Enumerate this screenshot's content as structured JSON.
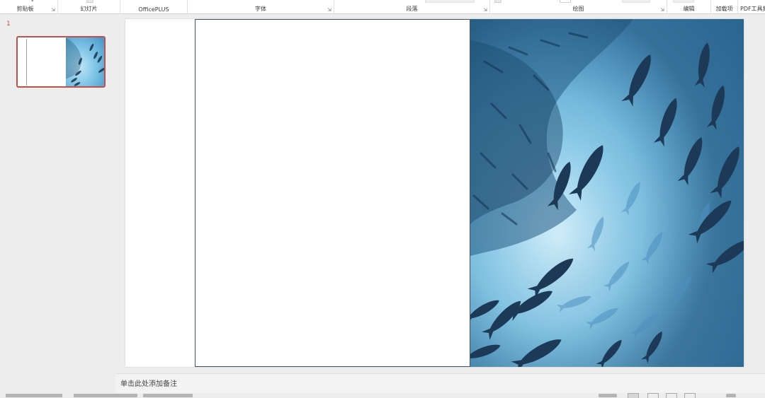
{
  "ribbon": {
    "groups": [
      {
        "label": "剪贴板",
        "launcher": "⇲"
      },
      {
        "label": "幻灯片"
      },
      {
        "label": "OfficePLUS"
      },
      {
        "label": "字体",
        "launcher": "⇲"
      },
      {
        "label": "段落",
        "launcher": "⇲"
      },
      {
        "label": "绘图",
        "launcher": "⇲"
      },
      {
        "label": "编辑"
      },
      {
        "label": "加载项"
      },
      {
        "label": "PDF工具集"
      }
    ]
  },
  "thumbnails": [
    {
      "number": "1",
      "selected": true
    }
  ],
  "notes": {
    "placeholder": "单击此处添加备注"
  },
  "colors": {
    "selection_accent": "#c0504d",
    "textbox_border": "#44546a",
    "app_background": "#ededed"
  },
  "image": {
    "semantic": "underwater-school-of-fish-photo"
  }
}
